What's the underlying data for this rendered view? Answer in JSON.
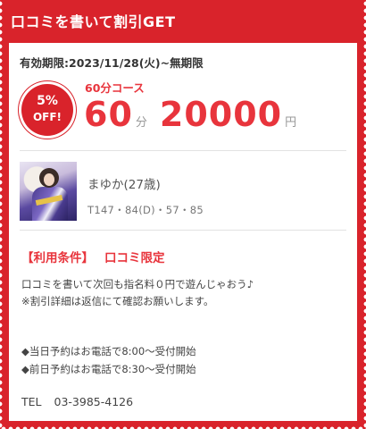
{
  "header": {
    "title": "口コミを書いて割引GET"
  },
  "coupon": {
    "validity": "有効期限:2023/11/28(火)~無期限",
    "badge_pct": "5%",
    "badge_off": "OFF!",
    "course": "60分コース",
    "minutes": "60",
    "minutes_unit": "分",
    "price": "20000",
    "price_unit": "円"
  },
  "girl": {
    "name": "まゆか(27歳)",
    "stats": "T147・84(D)・57・85"
  },
  "conditions": {
    "label": "【利用条件】",
    "value": "口コミ限定",
    "line1": "口コミを書いて次回も指名料０円で遊んじゃおう♪",
    "line2": "※割引詳細は返信にて確認お願いします。",
    "line3": "◆当日予約はお電話で8:00～受付開始",
    "line4": "◆前日予約はお電話で8:30～受付開始",
    "tel_label": "TEL",
    "tel_number": "03-3985-4126"
  },
  "colors": {
    "accent": "#d9232b",
    "price": "#e8343c"
  }
}
